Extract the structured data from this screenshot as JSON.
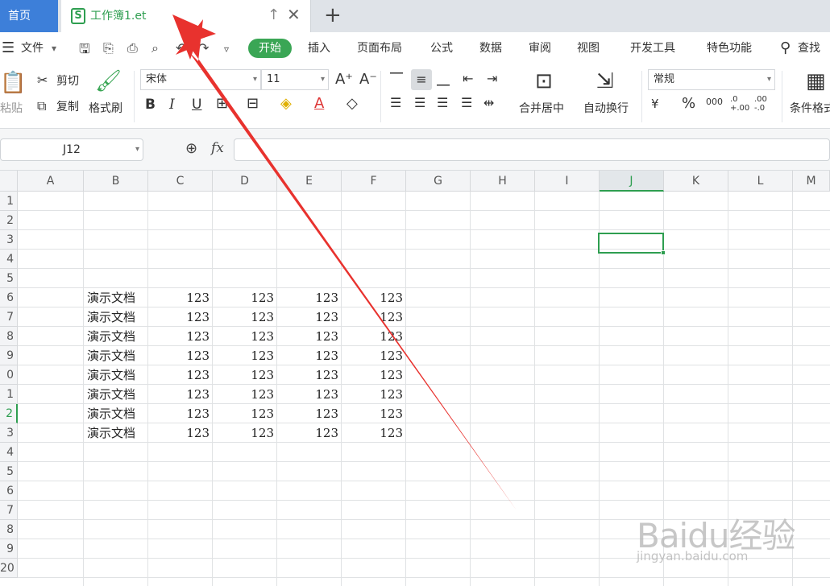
{
  "tabs": {
    "home": "首页",
    "document": "工作簿1.et",
    "new_tab": "+"
  },
  "menu": {
    "file": "文件",
    "items": [
      "开始",
      "插入",
      "页面布局",
      "公式",
      "数据",
      "审阅",
      "视图",
      "开发工具",
      "特色功能"
    ],
    "search": "查找"
  },
  "ribbon": {
    "paste": "粘贴",
    "cut": "剪切",
    "copy": "复制",
    "format_painter": "格式刷",
    "font_name": "宋体",
    "font_size": "11",
    "bold": "B",
    "italic": "I",
    "underline": "U",
    "font_color_glyph": "A",
    "merge_center": "合并居中",
    "wrap_text": "自动换行",
    "number_format": "常规",
    "currency": "¥",
    "percent": "%",
    "thousands": "000",
    "inc_decimal": ".0 +.00",
    "dec_decimal": ".00 -.0",
    "conditional_format": "条件格式"
  },
  "formula_bar": {
    "name_box": "J12",
    "fx": "fx",
    "formula": ""
  },
  "grid": {
    "columns": [
      "A",
      "B",
      "C",
      "D",
      "E",
      "F",
      "G",
      "H",
      "I",
      "J",
      "K",
      "L",
      "M"
    ],
    "rows": [
      "1",
      "2",
      "3",
      "4",
      "5",
      "6",
      "7",
      "8",
      "9",
      "0",
      "1",
      "2",
      "3",
      "4",
      "5",
      "6",
      "7",
      "8",
      "9",
      "20"
    ],
    "active_column": "J",
    "active_row_index": 11,
    "data_rows": [
      [
        "演示文档",
        "123",
        "123",
        "123",
        "123"
      ],
      [
        "演示文档",
        "123",
        "123",
        "123",
        "123"
      ],
      [
        "演示文档",
        "123",
        "123",
        "123",
        "123"
      ],
      [
        "演示文档",
        "123",
        "123",
        "123",
        "123"
      ],
      [
        "演示文档",
        "123",
        "123",
        "123",
        "123"
      ],
      [
        "演示文档",
        "123",
        "123",
        "123",
        "123"
      ],
      [
        "演示文档",
        "123",
        "123",
        "123",
        "123"
      ],
      [
        "演示文档",
        "123",
        "123",
        "123",
        "123"
      ]
    ]
  },
  "watermark": {
    "logo": "Baidu经验",
    "url": "jingyan.baidu.com"
  },
  "colors": {
    "accent_green": "#2e9e50",
    "home_blue": "#3d7fd9",
    "arrow_red": "#e8322e"
  }
}
